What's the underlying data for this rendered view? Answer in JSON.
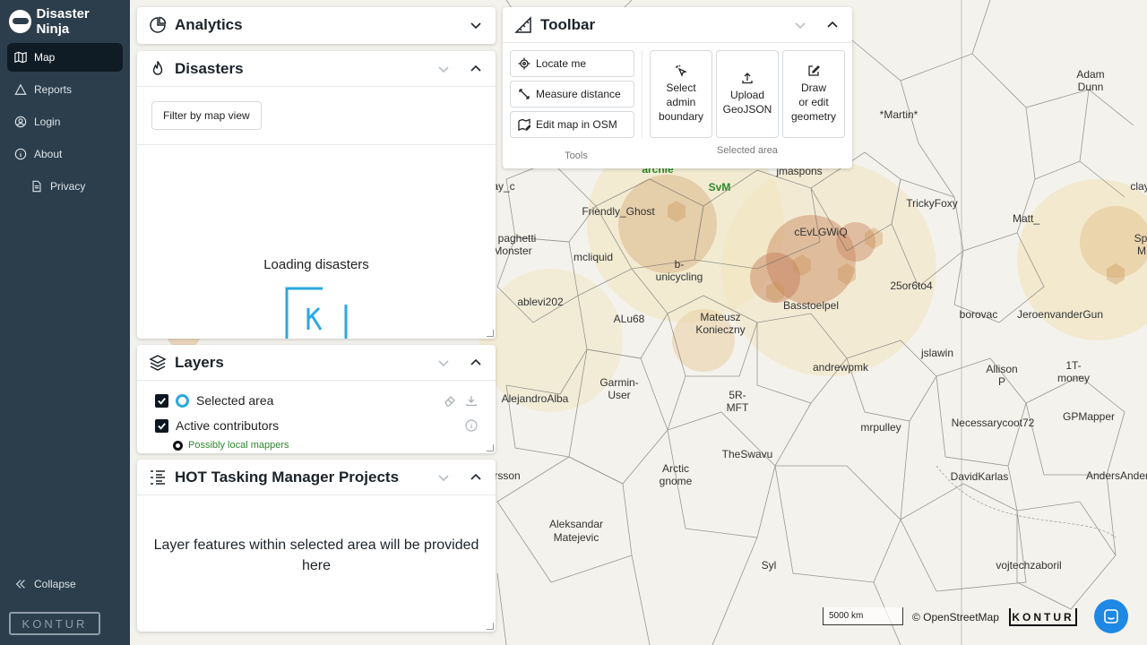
{
  "app": {
    "title": "Disaster Ninja",
    "brand": "KONTUR"
  },
  "sidebar": {
    "items": [
      {
        "label": "Map",
        "icon": "map-icon"
      },
      {
        "label": "Reports",
        "icon": "triangle-icon"
      },
      {
        "label": "Login",
        "icon": "user-icon"
      },
      {
        "label": "About",
        "icon": "info-icon"
      },
      {
        "label": "Privacy",
        "icon": "document-icon"
      }
    ],
    "collapse_label": "Collapse"
  },
  "panels": {
    "analytics": {
      "title": "Analytics"
    },
    "disasters": {
      "title": "Disasters",
      "filter_label": "Filter by map view",
      "loading_text": "Loading disasters"
    },
    "layers": {
      "title": "Layers",
      "items": [
        {
          "label": "Selected area",
          "checked": true
        },
        {
          "label": "Active contributors",
          "checked": true
        }
      ],
      "legend": "Possibly local mappers"
    },
    "hot": {
      "title": "HOT Tasking Manager Projects",
      "placeholder": "Layer features within selected area will be provided here"
    },
    "toolbar": {
      "title": "Toolbar",
      "tools": [
        "Locate me",
        "Measure distance",
        "Edit map in OSM"
      ],
      "tools_caption": "Tools",
      "area_buttons": [
        {
          "line1": "Select",
          "line2": "admin",
          "line3": "boundary"
        },
        {
          "line1": "Upload",
          "line2": "GeoJSON",
          "line3": ""
        },
        {
          "line1": "Draw",
          "line2": "or edit",
          "line3": "geometry"
        }
      ],
      "area_caption": "Selected area"
    }
  },
  "map": {
    "labels": [
      {
        "text": "archie",
        "green": true
      },
      {
        "text": "SvM",
        "green": true
      },
      {
        "text": "jmaspons"
      },
      {
        "text": "Friendly_Ghost"
      },
      {
        "text": "paghetti"
      },
      {
        "text": "Monster"
      },
      {
        "text": "mcliquid"
      },
      {
        "text": "b-"
      },
      {
        "text": "unicycling"
      },
      {
        "text": "cEvLGWiQ"
      },
      {
        "text": "ablevi202"
      },
      {
        "text": "ALu68"
      },
      {
        "text": "Mateusz"
      },
      {
        "text": "Konieczny"
      },
      {
        "text": "Basstoelpel"
      },
      {
        "text": "25or6to4"
      },
      {
        "text": "andrewpmk"
      },
      {
        "text": "jslawin"
      },
      {
        "text": "Garmin-"
      },
      {
        "text": "User"
      },
      {
        "text": "5R-"
      },
      {
        "text": "MFT"
      },
      {
        "text": "AlejandroAlba"
      },
      {
        "text": "mrpulley"
      },
      {
        "text": "TheSwavu"
      },
      {
        "text": "Arctic"
      },
      {
        "text": "gnome"
      },
      {
        "text": "Aleksandar"
      },
      {
        "text": "Matejevic"
      },
      {
        "text": "Syl"
      },
      {
        "text": "rsson"
      },
      {
        "text": "*Martin*"
      },
      {
        "text": "Adam"
      },
      {
        "text": "Dunn"
      },
      {
        "text": "TrickyFoxy"
      },
      {
        "text": "Matt_"
      },
      {
        "text": "clay"
      },
      {
        "text": "ay_c"
      },
      {
        "text": "borovac"
      },
      {
        "text": "JeroenvanderGun"
      },
      {
        "text": "Allison"
      },
      {
        "text": "P"
      },
      {
        "text": "1T-"
      },
      {
        "text": "money"
      },
      {
        "text": "Necessarycoot72"
      },
      {
        "text": "GPMapper"
      },
      {
        "text": "DavidKarlas"
      },
      {
        "text": "AndersAnders"
      },
      {
        "text": "vojtechzaboril"
      },
      {
        "text": "Sp"
      },
      {
        "text": "M"
      }
    ],
    "scale": "5000 km",
    "attribution": "© OpenStreetMap",
    "attribution_logo": "KONTUR"
  }
}
